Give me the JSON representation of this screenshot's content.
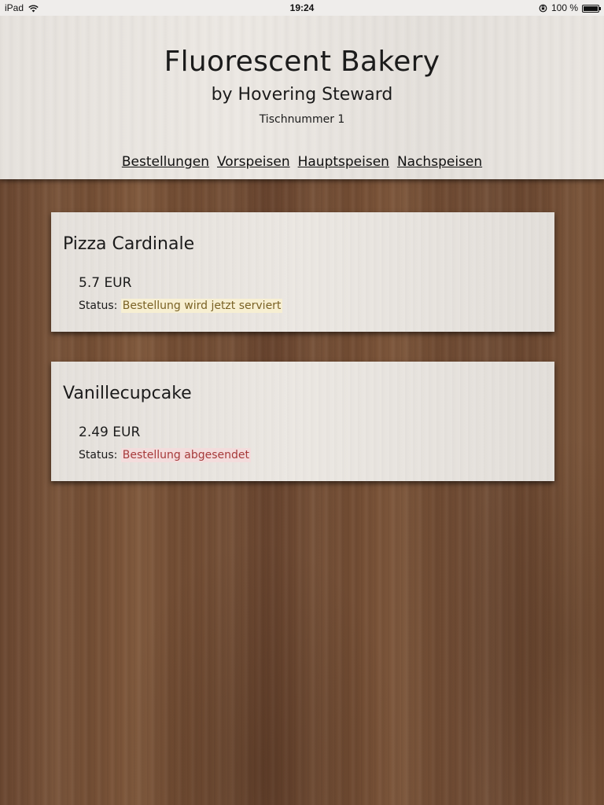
{
  "statusbar": {
    "device": "iPad",
    "time": "19:24",
    "battery_text": "100 %",
    "battery_level": 1.0,
    "icons": [
      "wifi-icon",
      "rotation-lock-icon",
      "battery-icon"
    ]
  },
  "header": {
    "title": "Fluorescent Bakery",
    "subtitle": "by Hovering Steward",
    "table_number": "Tischnummer 1"
  },
  "nav": {
    "items": [
      {
        "label": "Bestellungen"
      },
      {
        "label": "Vorspeisen"
      },
      {
        "label": "Hauptspeisen"
      },
      {
        "label": "Nachspeisen"
      }
    ]
  },
  "orders": [
    {
      "name": "Pizza Cardinale",
      "price": "5.7 EUR",
      "status_label": "Status:",
      "status": "Bestellung wird jetzt serviert",
      "status_bg": "#f7efd2",
      "status_color": "#7a6225"
    },
    {
      "name": "Vanillecupcake",
      "price": "2.49 EUR",
      "status_label": "Status:",
      "status": "Bestellung abgesendet",
      "status_bg": "#f3dcdc",
      "status_color": "#a63a3a"
    }
  ]
}
